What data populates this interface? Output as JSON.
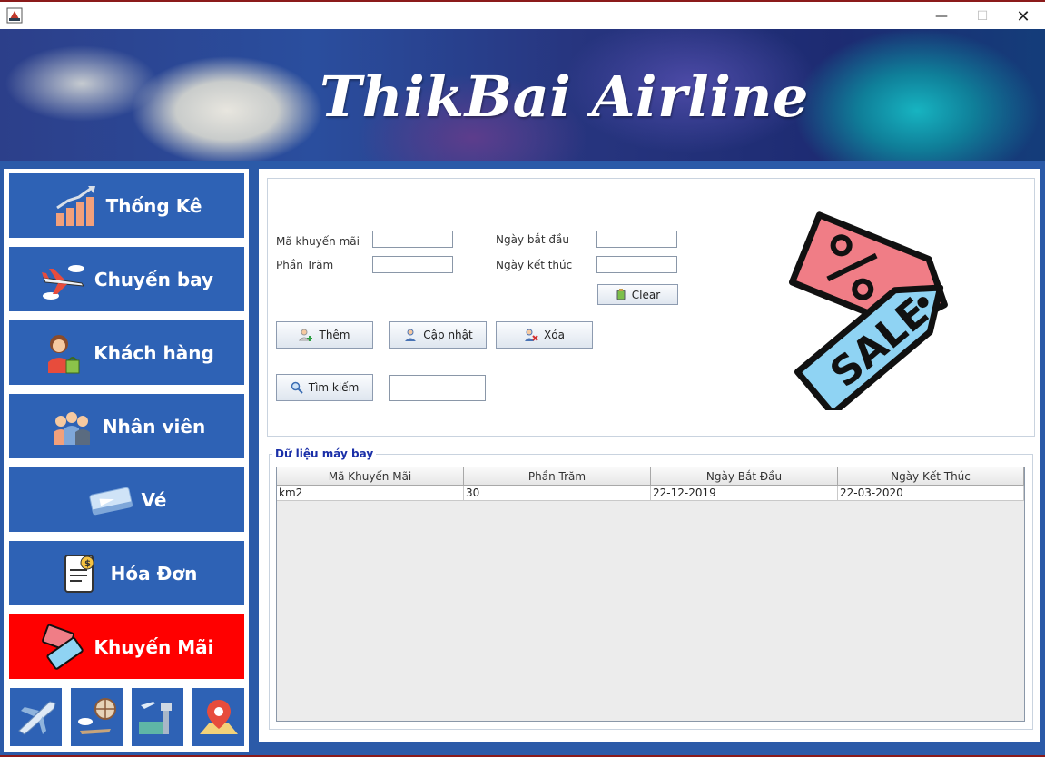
{
  "window": {
    "min_glyph": "—",
    "max_glyph": "☐",
    "close_glyph": "✕"
  },
  "banner": {
    "title": "ThikBai Airline"
  },
  "sidebar": {
    "items": [
      {
        "label": "Thống Kê",
        "icon": "bar-chart-icon"
      },
      {
        "label": "Chuyến bay",
        "icon": "airplane-icon"
      },
      {
        "label": "Khách hàng",
        "icon": "customer-icon"
      },
      {
        "label": "Nhân viên",
        "icon": "staff-icon"
      },
      {
        "label": "Vé",
        "icon": "ticket-icon"
      },
      {
        "label": "Hóa Đơn",
        "icon": "invoice-icon"
      },
      {
        "label": "Khuyến Mãi",
        "icon": "sale-tag-icon",
        "active": true
      }
    ],
    "tiles": [
      "plane-tile-icon",
      "globe-travel-icon",
      "airport-icon",
      "map-pin-icon"
    ]
  },
  "form": {
    "ma_khuyen_mai_label": "Mã khuyến mãi",
    "phan_tram_label": "Phần Trăm",
    "ngay_bat_dau_label": "Ngày bắt đầu",
    "ngay_ket_thuc_label": "Ngày kết thúc",
    "ma_khuyen_mai_value": "",
    "phan_tram_value": "",
    "ngay_bat_dau_value": "",
    "ngay_ket_thuc_value": "",
    "clear_label": "Clear",
    "them_label": "Thêm",
    "cap_nhat_label": "Cập nhật",
    "xoa_label": "Xóa",
    "tim_kiem_label": "Tìm kiếm",
    "search_value": ""
  },
  "table": {
    "group_title": "Dữ liệu máy bay",
    "columns": [
      "Mã Khuyến Mãi",
      "Phần Trăm",
      "Ngày Bắt Đầu",
      "Ngày Kết Thúc"
    ],
    "rows": [
      [
        "km2",
        "30",
        "22-12-2019",
        "22-03-2020"
      ]
    ]
  },
  "colors": {
    "sidebar_blue": "#2e62b5",
    "active_red": "#ff0000",
    "frame_blue": "#2b5aa8",
    "group_title_blue": "#1a2fa8"
  }
}
